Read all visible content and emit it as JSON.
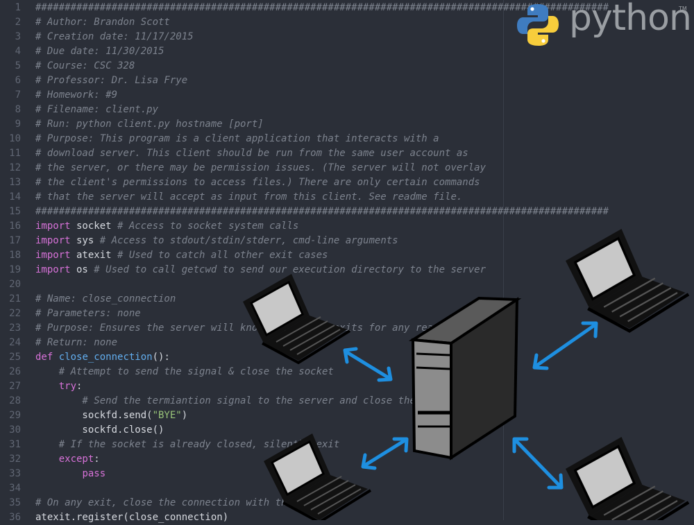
{
  "lines": [
    {
      "n": "1",
      "parts": [
        {
          "t": "##################################################################################################",
          "c": "cm"
        }
      ]
    },
    {
      "n": "2",
      "parts": [
        {
          "t": "# Author: Brandon Scott",
          "c": "cm"
        }
      ]
    },
    {
      "n": "3",
      "parts": [
        {
          "t": "# Creation date: 11/17/2015",
          "c": "cm"
        }
      ]
    },
    {
      "n": "4",
      "parts": [
        {
          "t": "# Due date: 11/30/2015",
          "c": "cm"
        }
      ]
    },
    {
      "n": "5",
      "parts": [
        {
          "t": "# Course: CSC 328",
          "c": "cm"
        }
      ]
    },
    {
      "n": "6",
      "parts": [
        {
          "t": "# Professor: Dr. Lisa Frye",
          "c": "cm"
        }
      ]
    },
    {
      "n": "7",
      "parts": [
        {
          "t": "# Homework: #9",
          "c": "cm"
        }
      ]
    },
    {
      "n": "8",
      "parts": [
        {
          "t": "# Filename: client.py",
          "c": "cm"
        }
      ]
    },
    {
      "n": "9",
      "parts": [
        {
          "t": "# Run: python client.py hostname [port]",
          "c": "cm"
        }
      ]
    },
    {
      "n": "10",
      "parts": [
        {
          "t": "# Purpose: This program is a client application that interacts with a",
          "c": "cm"
        }
      ]
    },
    {
      "n": "11",
      "parts": [
        {
          "t": "# download server. This client should be run from the same user account as",
          "c": "cm"
        }
      ]
    },
    {
      "n": "12",
      "parts": [
        {
          "t": "# the server, or there may be permission issues. (The server will not overlay",
          "c": "cm"
        }
      ]
    },
    {
      "n": "13",
      "parts": [
        {
          "t": "# the client's permissions to access files.) There are only certain commands",
          "c": "cm"
        }
      ]
    },
    {
      "n": "14",
      "parts": [
        {
          "t": "# that the server will accept as input from this client. See readme file.",
          "c": "cm"
        }
      ]
    },
    {
      "n": "15",
      "parts": [
        {
          "t": "##################################################################################################",
          "c": "cm"
        }
      ]
    },
    {
      "n": "16",
      "parts": [
        {
          "t": "import",
          "c": "kw"
        },
        {
          "t": " socket ",
          "c": "plain"
        },
        {
          "t": "# Access to socket system calls",
          "c": "cm"
        }
      ]
    },
    {
      "n": "17",
      "parts": [
        {
          "t": "import",
          "c": "kw"
        },
        {
          "t": " sys ",
          "c": "plain"
        },
        {
          "t": "# Access to stdout/stdin/stderr, cmd-line arguments",
          "c": "cm"
        }
      ]
    },
    {
      "n": "18",
      "parts": [
        {
          "t": "import",
          "c": "kw"
        },
        {
          "t": " atexit ",
          "c": "plain"
        },
        {
          "t": "# Used to catch all other exit cases",
          "c": "cm"
        }
      ]
    },
    {
      "n": "19",
      "parts": [
        {
          "t": "import",
          "c": "kw"
        },
        {
          "t": " os ",
          "c": "plain"
        },
        {
          "t": "# Used to call getcwd to send our execution directory to the server",
          "c": "cm"
        }
      ]
    },
    {
      "n": "20",
      "parts": []
    },
    {
      "n": "21",
      "parts": [
        {
          "t": "# Name: close_connection",
          "c": "cm"
        }
      ]
    },
    {
      "n": "22",
      "parts": [
        {
          "t": "# Parameters: none",
          "c": "cm"
        }
      ]
    },
    {
      "n": "23",
      "parts": [
        {
          "t": "# Purpose: Ensures the server will know the client exits for any reason",
          "c": "cm"
        }
      ]
    },
    {
      "n": "24",
      "parts": [
        {
          "t": "# Return: none",
          "c": "cm"
        }
      ]
    },
    {
      "n": "25",
      "parts": [
        {
          "t": "def",
          "c": "kw"
        },
        {
          "t": " ",
          "c": "plain"
        },
        {
          "t": "close_connection",
          "c": "fn"
        },
        {
          "t": "():",
          "c": "plain"
        }
      ]
    },
    {
      "n": "26",
      "parts": [
        {
          "t": "    # Attempt to send the signal & close the socket",
          "c": "cm"
        }
      ]
    },
    {
      "n": "27",
      "parts": [
        {
          "t": "    ",
          "c": "plain"
        },
        {
          "t": "try",
          "c": "kw"
        },
        {
          "t": ":",
          "c": "plain"
        }
      ]
    },
    {
      "n": "28",
      "parts": [
        {
          "t": "        # Send the termiantion signal to the server and close the socket",
          "c": "cm"
        }
      ]
    },
    {
      "n": "29",
      "parts": [
        {
          "t": "        sockfd.send(",
          "c": "plain"
        },
        {
          "t": "\"BYE\"",
          "c": "str"
        },
        {
          "t": ")",
          "c": "plain"
        }
      ]
    },
    {
      "n": "30",
      "parts": [
        {
          "t": "        sockfd.close()",
          "c": "plain"
        }
      ]
    },
    {
      "n": "31",
      "parts": [
        {
          "t": "    # If the socket is already closed, silently exit",
          "c": "cm"
        }
      ]
    },
    {
      "n": "32",
      "parts": [
        {
          "t": "    ",
          "c": "plain"
        },
        {
          "t": "except",
          "c": "kw"
        },
        {
          "t": ":",
          "c": "plain"
        }
      ]
    },
    {
      "n": "33",
      "parts": [
        {
          "t": "        ",
          "c": "plain"
        },
        {
          "t": "pass",
          "c": "kw"
        }
      ]
    },
    {
      "n": "34",
      "parts": []
    },
    {
      "n": "35",
      "parts": [
        {
          "t": "# On any exit, close the connection with the server",
          "c": "cm"
        }
      ]
    },
    {
      "n": "36",
      "parts": [
        {
          "t": "atexit.register(close_connection)",
          "c": "plain"
        }
      ]
    }
  ],
  "logo": {
    "text": "python",
    "trademark": "TM"
  },
  "colors": {
    "background": "#2b2f38",
    "comment": "#7d838e",
    "keyword": "#d772d8",
    "function": "#62aeef",
    "string": "#98c379",
    "arrow": "#1e8fe0"
  },
  "icons": [
    "python-logo-icon",
    "laptop-icon",
    "server-tower-icon",
    "double-arrow-icon"
  ]
}
